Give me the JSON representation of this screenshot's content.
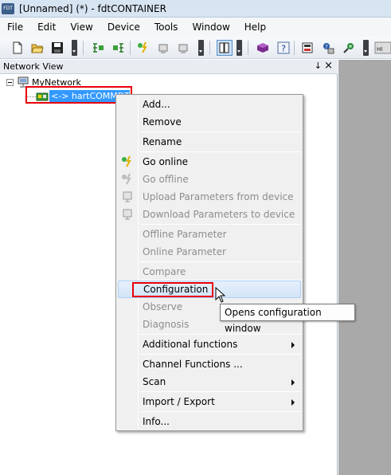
{
  "window": {
    "title": "[Unnamed] (*)  - fdtCONTAINER",
    "app_icon_text": "FDT"
  },
  "menubar": [
    "File",
    "Edit",
    "View",
    "Device",
    "Tools",
    "Window",
    "Help"
  ],
  "toolbar": {
    "icons": [
      "new-document-icon",
      "open-folder-icon",
      "save-icon",
      "add-device-icon",
      "remove-device-icon",
      "go-online-icon",
      "upload-icon",
      "download-icon",
      "network-view-icon",
      "catalog-icon",
      "help-icon",
      "print-icon",
      "settings-icon",
      "connect-icon",
      "hide-icon"
    ]
  },
  "panel": {
    "title": "Network View",
    "pin_glyph": "↓",
    "close_glyph": "×"
  },
  "tree": {
    "root": "MyNetwork",
    "child": "<-> hartCOMMDTM"
  },
  "context_menu": {
    "items": [
      {
        "label": "Add...",
        "disabled": false
      },
      {
        "label": "Remove",
        "disabled": false
      },
      {
        "label": "Rename",
        "disabled": false
      },
      {
        "label": "Go online",
        "disabled": false
      },
      {
        "label": "Go offline",
        "disabled": true
      },
      {
        "label": "Upload Parameters from device",
        "disabled": true
      },
      {
        "label": "Download Parameters to device",
        "disabled": true
      },
      {
        "label": "Offline Parameter",
        "disabled": true
      },
      {
        "label": "Online Parameter",
        "disabled": true
      },
      {
        "label": "Compare",
        "disabled": true
      },
      {
        "label": "Configuration",
        "disabled": false,
        "hovered": true
      },
      {
        "label": "Observe",
        "disabled": true
      },
      {
        "label": "Diagnosis",
        "disabled": true
      },
      {
        "label": "Additional functions",
        "disabled": false,
        "submenu": true
      },
      {
        "label": "Channel Functions ...",
        "disabled": false
      },
      {
        "label": "Scan",
        "disabled": false,
        "submenu": true
      },
      {
        "label": "Import / Export",
        "disabled": false,
        "submenu": true
      },
      {
        "label": "Info...",
        "disabled": false
      }
    ]
  },
  "tooltip": "Opens configuration window",
  "colors": {
    "selection": "#3399ff",
    "highlight_box": "#e8000b",
    "menu_bg": "#f0f0f0"
  }
}
